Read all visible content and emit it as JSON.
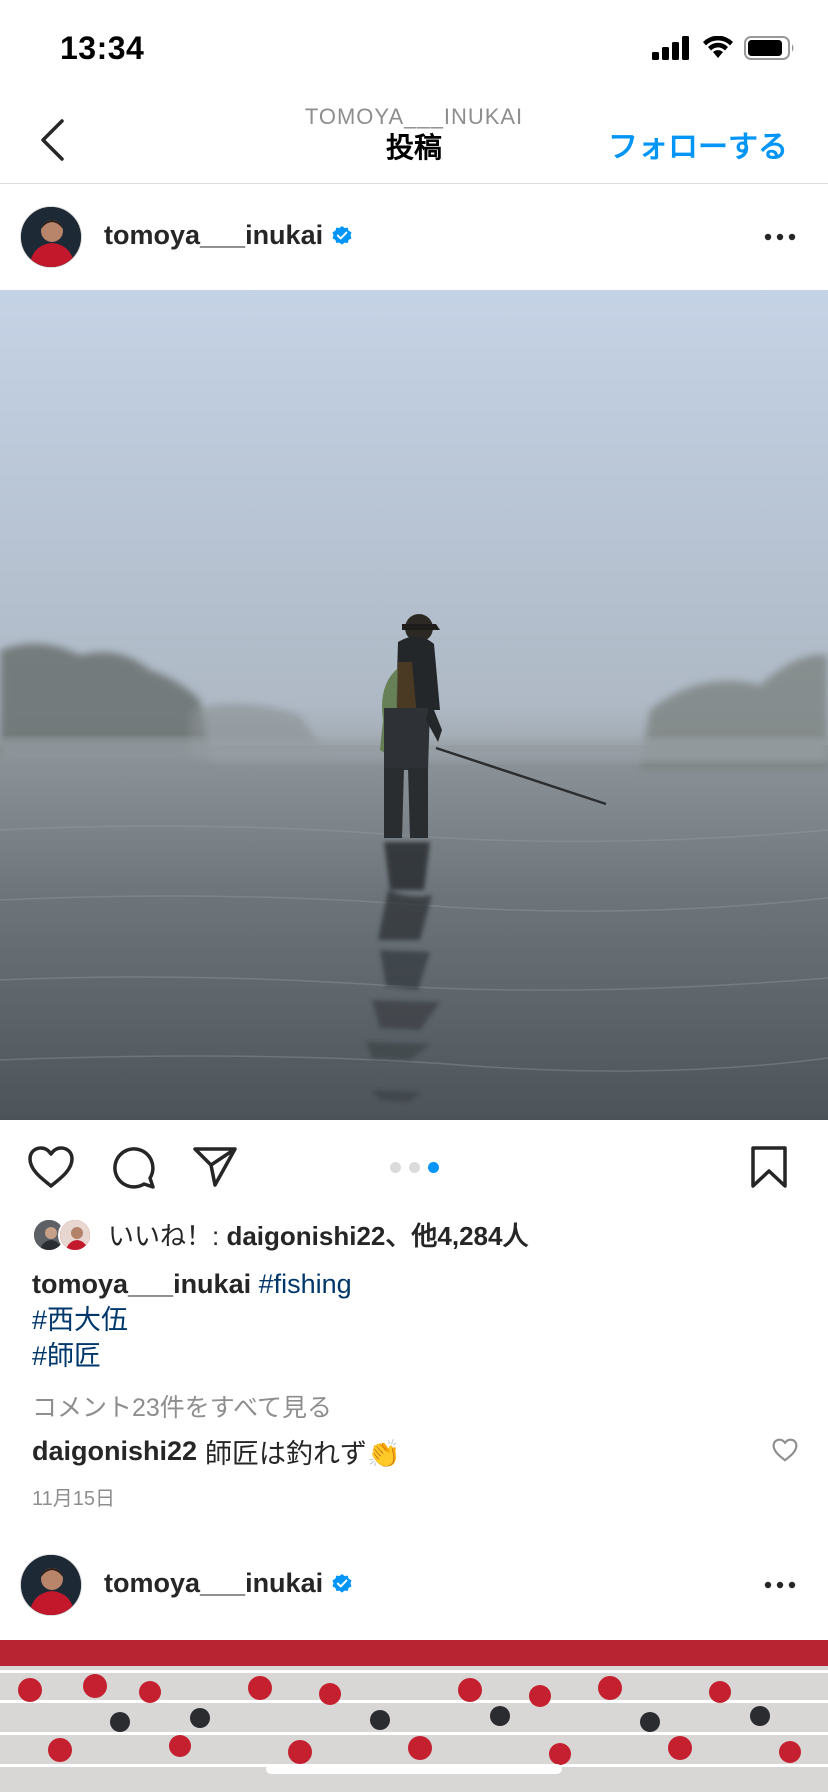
{
  "status_bar": {
    "time": "13:34"
  },
  "nav": {
    "subtitle": "TOMOYA___INUKAI",
    "title": "投稿",
    "follow_label": "フォローする"
  },
  "post": {
    "username": "tomoya___inukai",
    "verified": true,
    "carousel": {
      "total": 3,
      "active_index": 3
    },
    "likes": {
      "prefix": "いいね！: ",
      "user": "daigonishi22",
      "suffix": "、他",
      "count": "4,284人"
    },
    "caption": {
      "username": "tomoya___inukai",
      "hashtags": [
        "#fishing",
        "#西大伍",
        "#師匠"
      ]
    },
    "view_comments": "コメント23件をすべて見る",
    "top_comment": {
      "user": "daigonishi22",
      "text": "師匠は釣れず👏"
    },
    "date": "11月15日"
  },
  "next_post": {
    "username": "tomoya___inukai",
    "verified": true
  },
  "colors": {
    "accent": "#0095f6",
    "hashtag": "#00376b",
    "muted": "#8e8e8e",
    "verified": "#0095f6"
  },
  "icons": [
    "back-arrow-icon",
    "verified-badge-icon",
    "more-icon",
    "heart-icon",
    "comment-icon",
    "share-icon",
    "bookmark-icon",
    "signal-icon",
    "wifi-icon",
    "battery-icon"
  ]
}
